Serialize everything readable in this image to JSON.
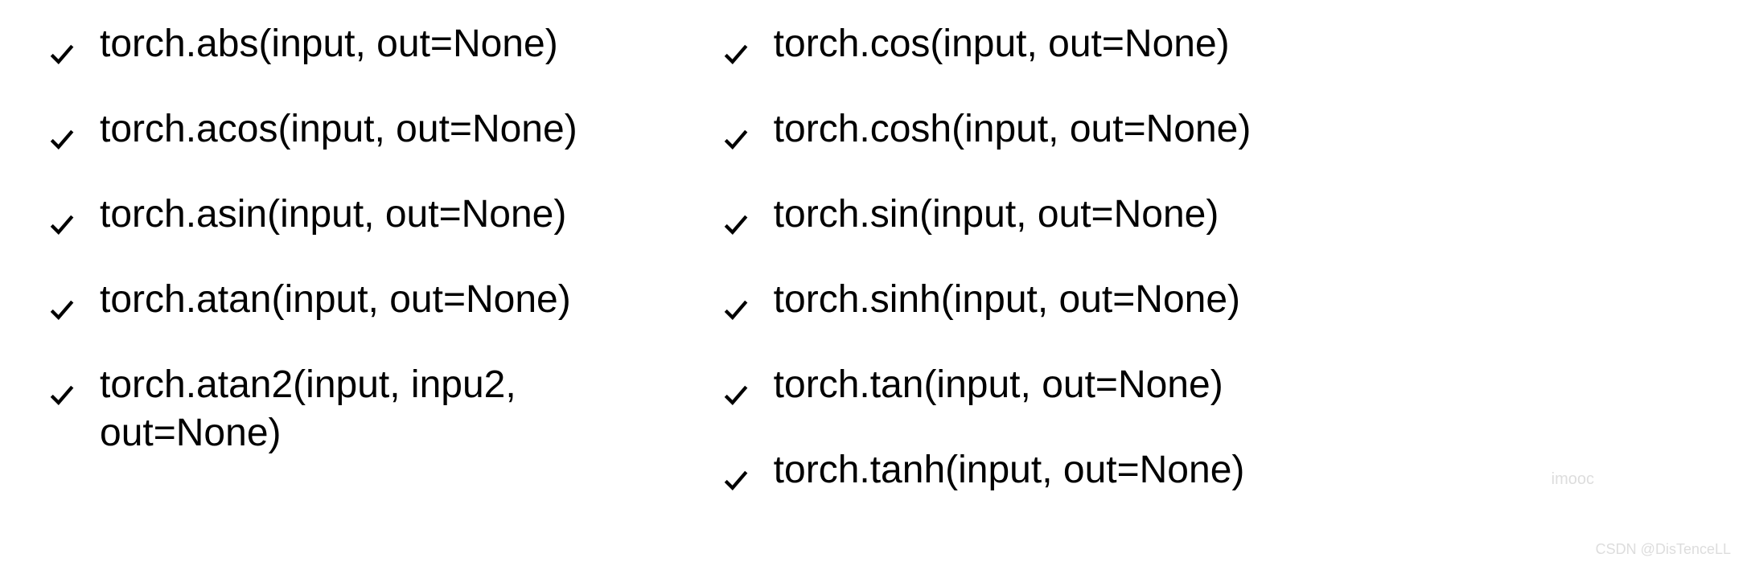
{
  "columns": {
    "left": {
      "items": [
        {
          "text": "torch.abs(input, out=None)"
        },
        {
          "text": "torch.acos(input, out=None)"
        },
        {
          "text": "torch.asin(input, out=None)"
        },
        {
          "text": "torch.atan(input, out=None)"
        },
        {
          "line1": "torch.atan2(input, inpu2,",
          "line2": "out=None)"
        }
      ]
    },
    "right": {
      "items": [
        {
          "text": "torch.cos(input, out=None)"
        },
        {
          "text": "torch.cosh(input, out=None)"
        },
        {
          "text": "torch.sin(input, out=None)"
        },
        {
          "text": "torch.sinh(input, out=None)"
        },
        {
          "text": "torch.tan(input, out=None)"
        },
        {
          "text": "torch.tanh(input, out=None)"
        }
      ]
    }
  },
  "watermarks": {
    "imooc": "imooc",
    "csdn": "CSDN @DisTenceLL"
  }
}
